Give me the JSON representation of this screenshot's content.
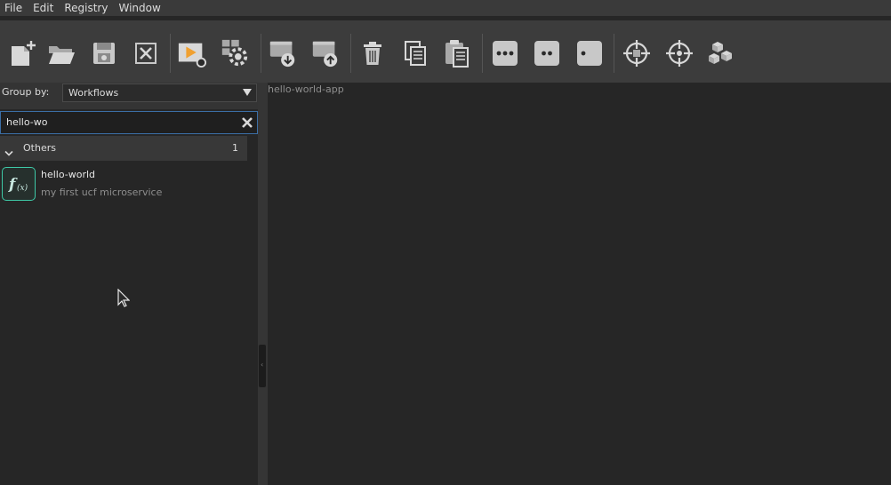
{
  "menu": {
    "items": [
      {
        "label": "File"
      },
      {
        "label": "Edit"
      },
      {
        "label": "Registry"
      },
      {
        "label": "Window"
      }
    ]
  },
  "toolbar": {
    "buttons": [
      {
        "icon": "new-file-icon"
      },
      {
        "icon": "open-folder-icon"
      },
      {
        "icon": "save-icon"
      },
      {
        "icon": "close-icon"
      },
      {
        "icon": "run-icon"
      },
      {
        "icon": "settings-icon"
      },
      {
        "icon": "import-icon"
      },
      {
        "icon": "export-icon"
      },
      {
        "icon": "trash-icon"
      },
      {
        "icon": "copy-icon"
      },
      {
        "icon": "paste-icon"
      },
      {
        "icon": "three-dots-icon"
      },
      {
        "icon": "two-dots-icon"
      },
      {
        "icon": "one-dot-icon"
      },
      {
        "icon": "target-icon"
      },
      {
        "icon": "target-alt-icon"
      },
      {
        "icon": "cubes-icon"
      }
    ]
  },
  "sidebar": {
    "group_by_label": "Group by:",
    "group_by_value": "Workflows",
    "search_value": "hello-wo",
    "group": {
      "title": "Others",
      "count": "1"
    },
    "items": [
      {
        "title": "hello-world",
        "description": "my first ucf microservice",
        "icon": "function-icon"
      }
    ]
  },
  "main": {
    "title": "hello-world-app"
  },
  "colors": {
    "accent": "#3ec9a7",
    "run": "#f0a030",
    "focus": "#3b6ea5"
  }
}
